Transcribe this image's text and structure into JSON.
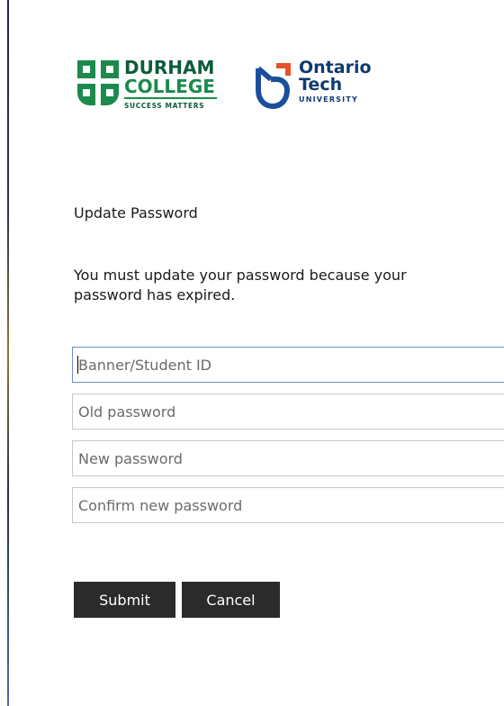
{
  "logos": {
    "durham_college": {
      "line1": "DURHAM",
      "line2": "COLLEGE",
      "tagline": "SUCCESS MATTERS",
      "color": "#0d5c3a"
    },
    "ontario_tech": {
      "line1": "Ontario",
      "line2": "Tech",
      "line3": "UNIVERSITY",
      "color": "#0f3a72",
      "accent": "#e8532b"
    }
  },
  "form": {
    "title": "Update Password",
    "message": "You must update your password because your password has expired.",
    "fields": {
      "student_id": {
        "placeholder": "Banner/Student ID",
        "value": ""
      },
      "old_password": {
        "placeholder": "Old password",
        "value": ""
      },
      "new_password": {
        "placeholder": "New password",
        "value": ""
      },
      "confirm_password": {
        "placeholder": "Confirm new password",
        "value": ""
      }
    },
    "buttons": {
      "submit": "Submit",
      "cancel": "Cancel"
    }
  }
}
